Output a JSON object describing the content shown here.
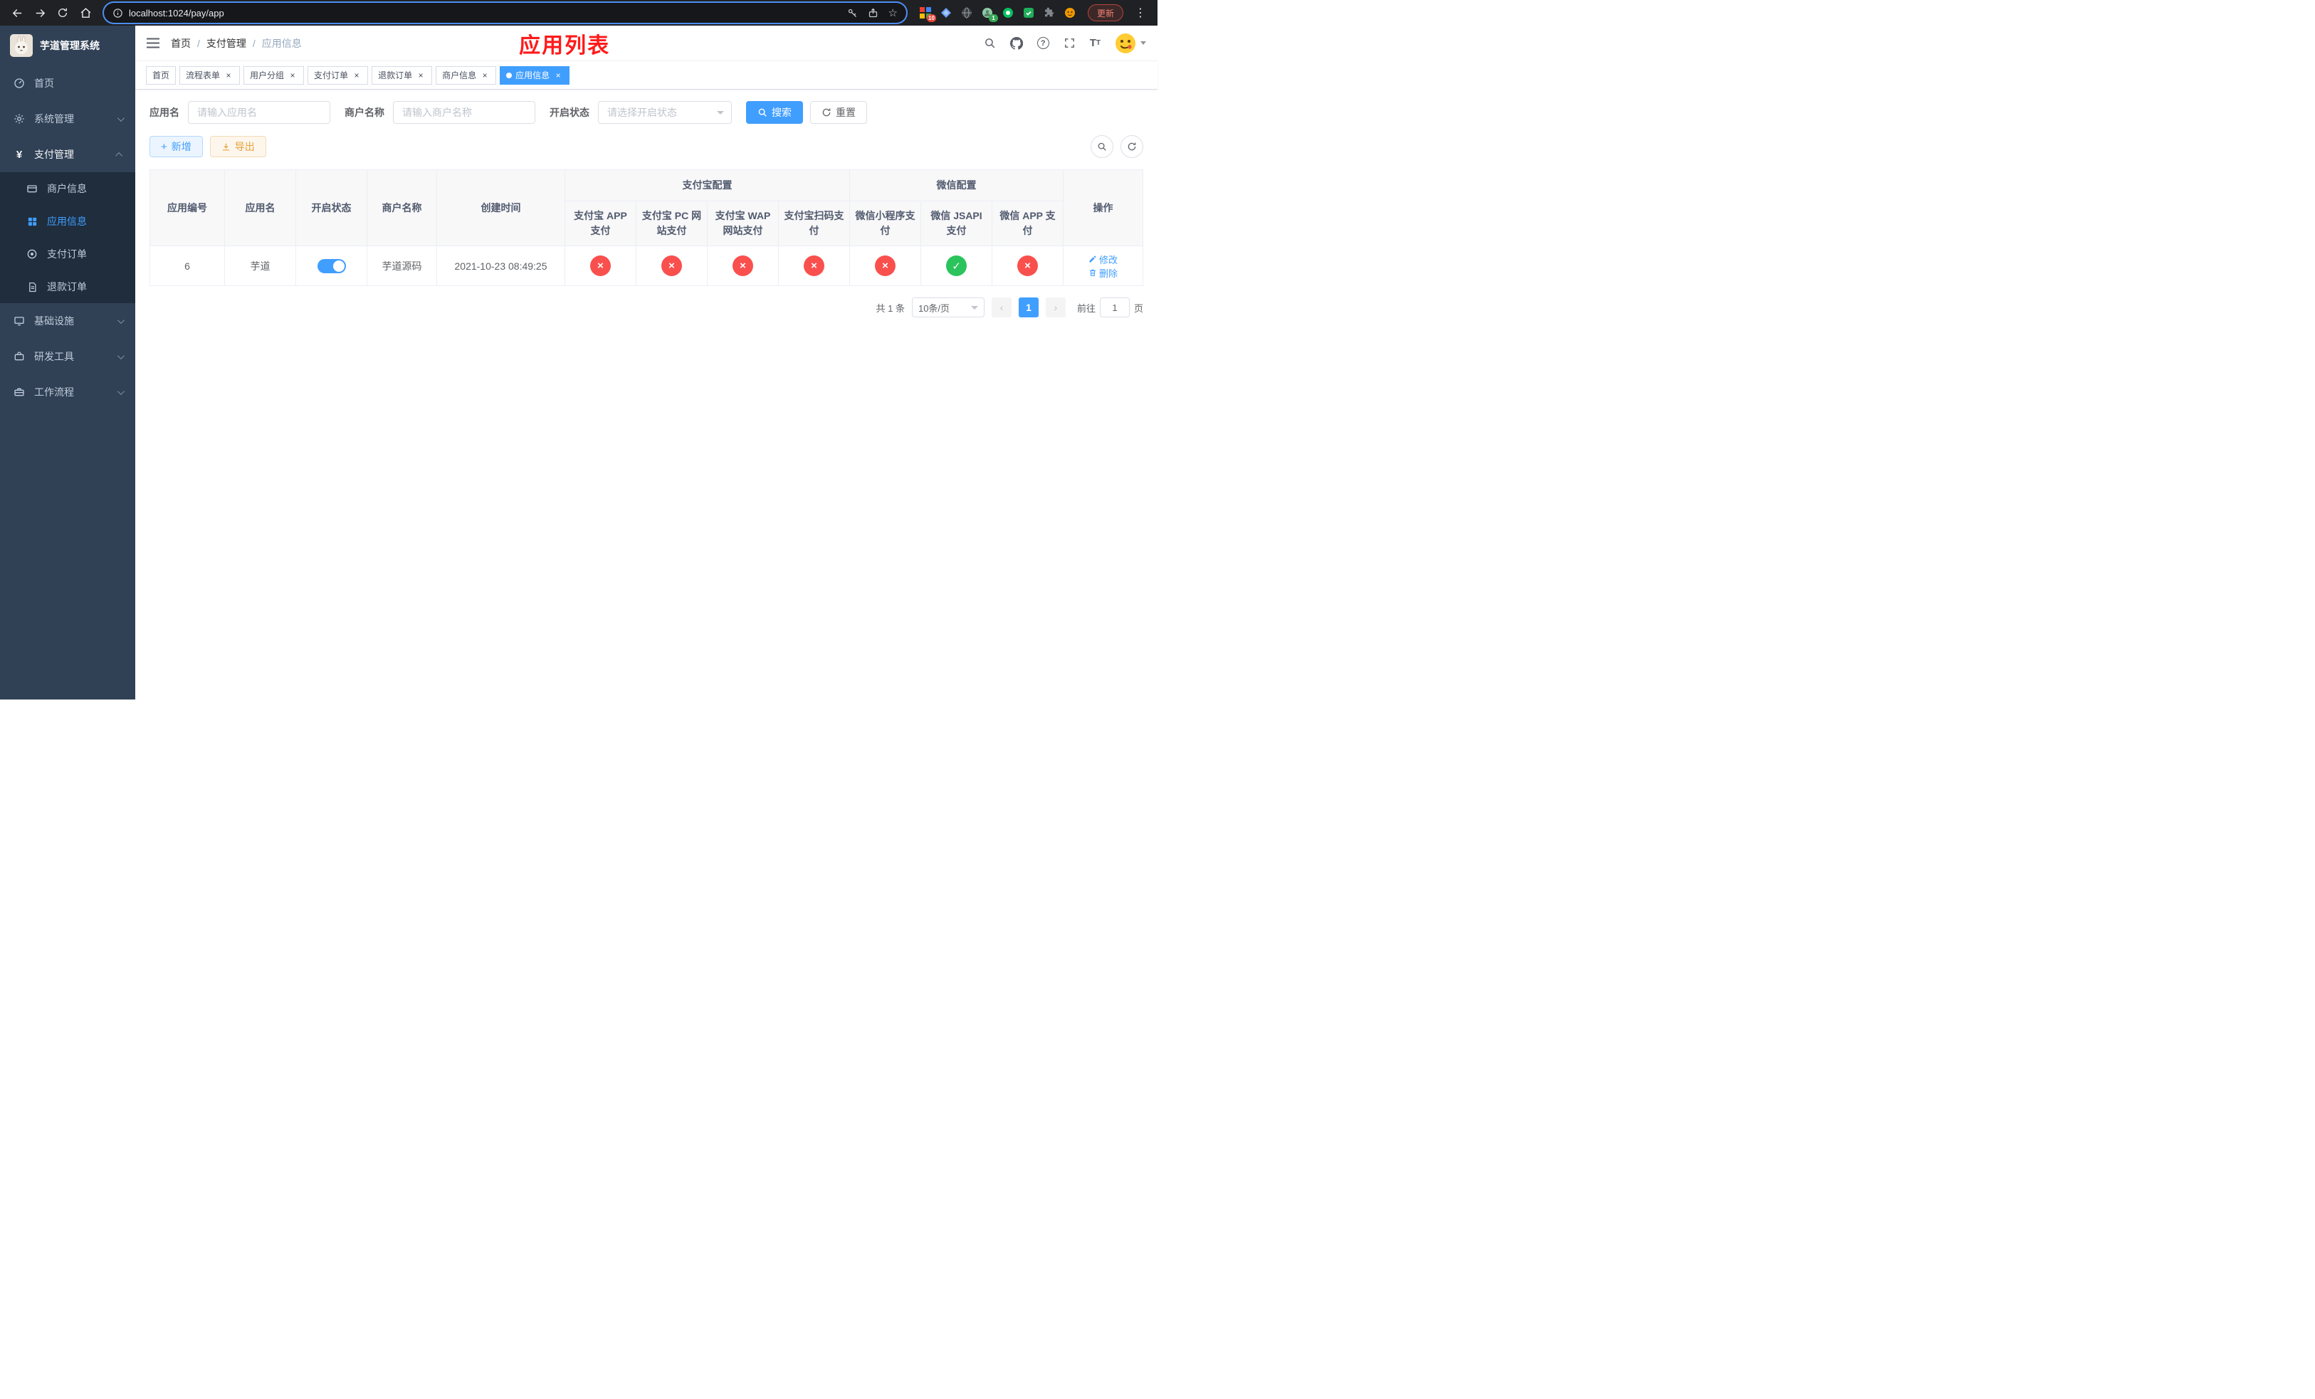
{
  "browser": {
    "url": "localhost:1024/pay/app",
    "update_label": "更新",
    "extension_badges": {
      "mosaic": "10",
      "avatar": "1"
    }
  },
  "sidebar": {
    "title": "芋道管理系统",
    "items": {
      "home": {
        "label": "首页"
      },
      "system": {
        "label": "系统管理"
      },
      "payment": {
        "label": "支付管理",
        "expanded": true
      },
      "infra": {
        "label": "基础设施"
      },
      "devtools": {
        "label": "研发工具"
      },
      "workflow": {
        "label": "工作流程"
      }
    },
    "payment_children": {
      "merchant": {
        "label": "商户信息"
      },
      "app": {
        "label": "应用信息",
        "active": true
      },
      "pay_order": {
        "label": "支付订单"
      },
      "refund_order": {
        "label": "退款订单"
      }
    }
  },
  "header": {
    "breadcrumb_home": "首页",
    "breadcrumb_module": "支付管理",
    "breadcrumb_page": "应用信息",
    "annotation": "应用列表"
  },
  "tabs": [
    {
      "label": "首页",
      "closable": false
    },
    {
      "label": "流程表单",
      "closable": true
    },
    {
      "label": "用户分组",
      "closable": true
    },
    {
      "label": "支付订单",
      "closable": true
    },
    {
      "label": "退款订单",
      "closable": true
    },
    {
      "label": "商户信息",
      "closable": true
    },
    {
      "label": "应用信息",
      "closable": true,
      "active": true
    }
  ],
  "filters": {
    "app_name_label": "应用名",
    "app_name_placeholder": "请输入应用名",
    "merchant_label": "商户名称",
    "merchant_placeholder": "请输入商户名称",
    "status_label": "开启状态",
    "status_placeholder": "请选择开启状态",
    "search": "搜索",
    "reset": "重置"
  },
  "toolbar": {
    "add": "新增",
    "export": "导出"
  },
  "table": {
    "columns": {
      "app_id": "应用编号",
      "app_name": "应用名",
      "status": "开启状态",
      "merchant": "商户名称",
      "created": "创建时间",
      "alipay_group": "支付宝配置",
      "alipay_app": "支付宝 APP 支付",
      "alipay_pc": "支付宝 PC 网站支付",
      "alipay_wap": "支付宝 WAP 网站支付",
      "alipay_qr": "支付宝扫码支付",
      "wechat_group": "微信配置",
      "wx_mini": "微信小程序支付",
      "wx_jsapi": "微信 JSAPI 支付",
      "wx_app": "微信 APP 支付",
      "actions": "操作"
    },
    "row": {
      "app_id": "6",
      "app_name": "芋道",
      "status_on": true,
      "merchant": "芋道源码",
      "created": "2021-10-23 08:49:25",
      "alipay_app": "error",
      "alipay_pc": "error",
      "alipay_wap": "error",
      "alipay_qr": "error",
      "wx_mini": "error",
      "wx_jsapi": "success",
      "wx_app": "error",
      "edit": "修改",
      "delete": "删除"
    }
  },
  "pagination": {
    "total": "共 1 条",
    "page_size": "10条/页",
    "page": "1",
    "prev": "‹",
    "next": "›",
    "goto": "前往",
    "goto_value": "1",
    "unit": "页"
  },
  "icons": {
    "dots": "⋮",
    "star": "☆",
    "question": "?",
    "plus": "+",
    "yen": "¥"
  },
  "colors": {
    "primary": "#409EFF",
    "danger": "#F9504E",
    "success": "#2BC35C",
    "warning": "#E6A23C",
    "annotation": "#FF1A1A",
    "sidebar_bg": "#304156",
    "submenu_bg": "#1F2D3D"
  }
}
